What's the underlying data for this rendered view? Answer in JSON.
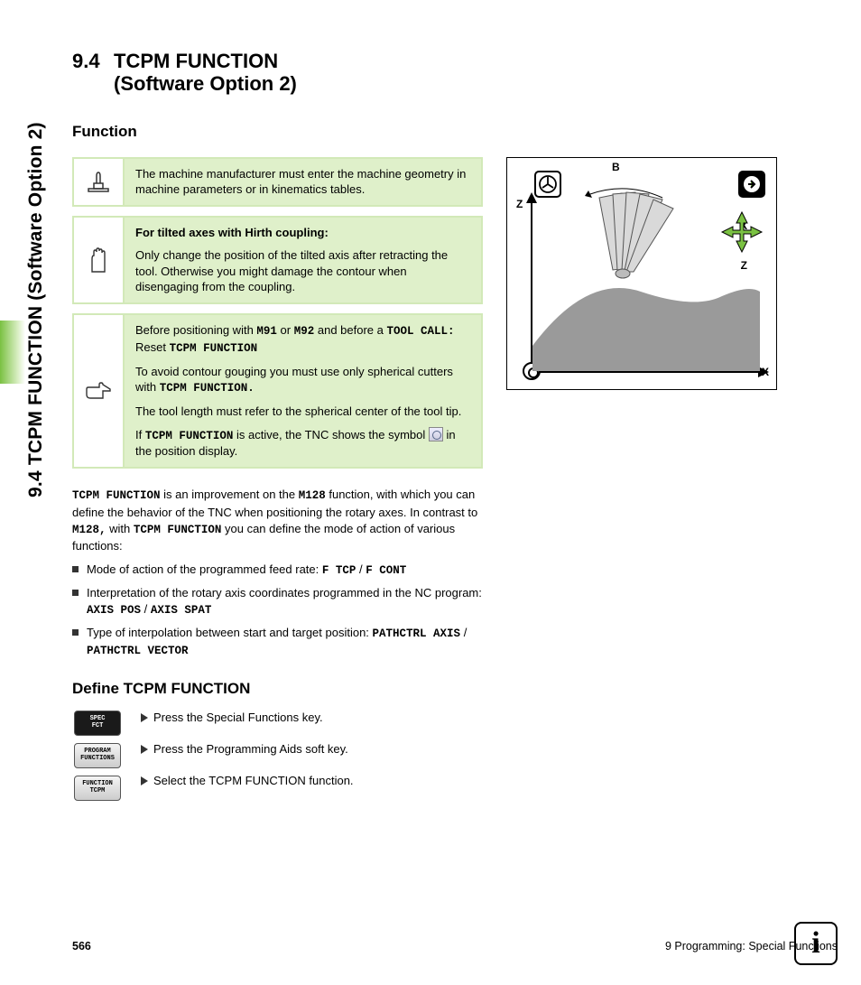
{
  "sideTab": "9.4 TCPM FUNCTION (Software Option 2)",
  "heading": {
    "num": "9.4",
    "title1": "TCPM FUNCTION",
    "title2": "(Software Option 2)"
  },
  "sub1": "Function",
  "notes": {
    "n1": "The machine manufacturer must enter the machine geometry in machine parameters or in kinematics tables.",
    "n2_title": "For tilted axes with Hirth coupling:",
    "n2_body": "Only change the position of the tilted axis after retracting the tool. Otherwise you might damage the contour when disengaging from the coupling.",
    "n3_a_pre": "Before positioning with ",
    "n3_a_m91": "M91",
    "n3_a_or": " or ",
    "n3_a_m92": "M92",
    "n3_a_mid": " and before a ",
    "n3_a_tc": "TOOL CALL:",
    "n3_a_post": " Reset ",
    "n3_a_tf": "TCPM FUNCTION",
    "n3_b_pre": "To avoid contour gouging you must use only spherical cutters with ",
    "n3_b_tf": "TCPM FUNCTION.",
    "n3_c": "The tool length must refer to the spherical center of the tool tip.",
    "n3_d_pre": "If ",
    "n3_d_tf": "TCPM FUNCTION",
    "n3_d_post": " is active, the TNC shows the symbol ",
    "n3_d_end": " in the position display."
  },
  "body": {
    "p1_tf": "TCPM FUNCTION",
    "p1_a": " is an improvement on the ",
    "p1_m128": "M128",
    "p1_b": " function, with which you can define the behavior of the TNC when positioning the rotary axes. In contrast to ",
    "p1_m128b": "M128,",
    "p1_c": " with ",
    "p1_tf2": "TCPM FUNCTION",
    "p1_d": " you can define the mode of action of various functions:"
  },
  "bullets": {
    "b1_a": "Mode of action of the programmed feed rate: ",
    "b1_code1": "F TCP",
    "b1_sep": " / ",
    "b1_code2": "F CONT",
    "b2_a": "Interpretation of the rotary axis coordinates programmed in the NC program: ",
    "b2_code1": "AXIS POS",
    "b2_sep": " / ",
    "b2_code2": "AXIS SPAT",
    "b3_a": "Type of interpolation between start and target position: ",
    "b3_code1": "PATHCTRL AXIS",
    "b3_sep": " / ",
    "b3_code2": "PATHCTRL VECTOR"
  },
  "sub2": "Define TCPM FUNCTION",
  "softkeys": {
    "k1a": "SPEC",
    "k1b": "FCT",
    "k2a": "PROGRAM",
    "k2b": "FUNCTIONS",
    "k3a": "FUNCTION",
    "k3b": "TCPM"
  },
  "steps": {
    "s1": "Press the Special Functions key.",
    "s2": "Press the Programming Aids soft key.",
    "s3": "Select the TCPM FUNCTION function."
  },
  "figure": {
    "B": "B",
    "Z": "Z",
    "X": "X",
    "Xr": "X",
    "Zr": "Z"
  },
  "footer": {
    "page": "566",
    "chapter": "9 Programming: Special Functions"
  },
  "info": "i"
}
